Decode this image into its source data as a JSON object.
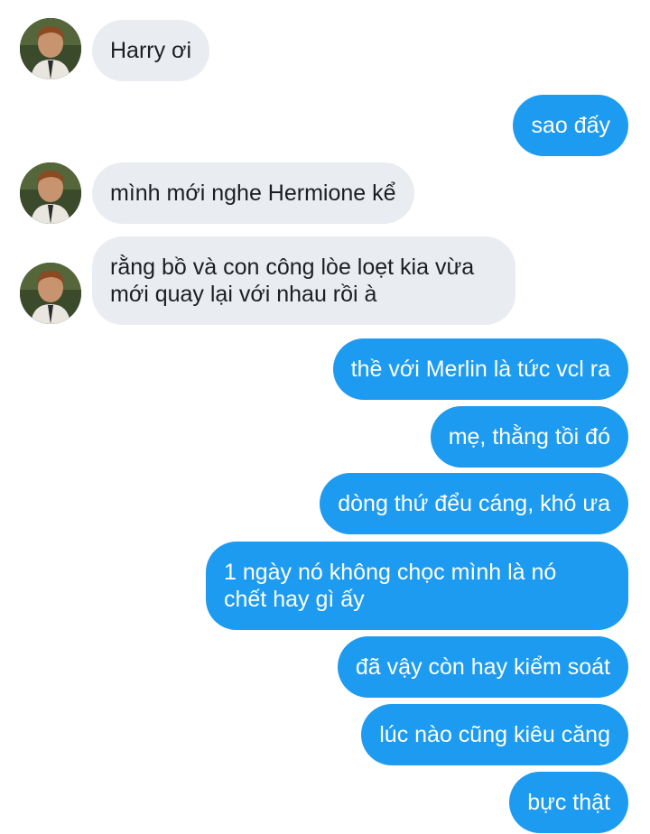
{
  "colors": {
    "incoming_bubble": "#e9ecf0",
    "outgoing_bubble": "#1d9bf0",
    "background": "#ffffff"
  },
  "messages": [
    {
      "sender": "other",
      "text": "Harry ơi"
    },
    {
      "sender": "me",
      "text": "sao đấy"
    },
    {
      "sender": "other",
      "text": "mình mới nghe Hermione kể"
    },
    {
      "sender": "other",
      "text": "rằng bồ và con công lòe loẹt kia vừa\nmới quay lại với nhau rồi à"
    },
    {
      "sender": "me",
      "text": "thề với Merlin là tức vcl ra"
    },
    {
      "sender": "me",
      "text": "mẹ, thằng tồi đó"
    },
    {
      "sender": "me",
      "text": "dòng thứ đểu cáng, khó ưa"
    },
    {
      "sender": "me",
      "text": "1 ngày nó không chọc mình là nó\nchết hay gì ấy"
    },
    {
      "sender": "me",
      "text": "đã vậy còn hay kiểm soát"
    },
    {
      "sender": "me",
      "text": "lúc nào cũng kiêu căng"
    },
    {
      "sender": "me",
      "text": "bực thật"
    }
  ],
  "avatar_icon": "avatar-icon"
}
